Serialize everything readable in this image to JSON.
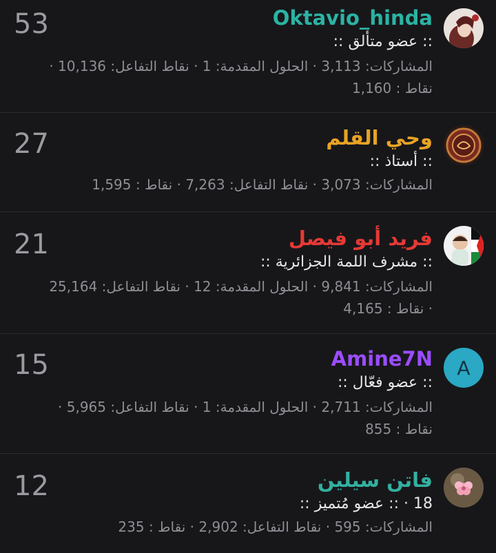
{
  "members": [
    {
      "score": "53",
      "username": "Oktavio_hinda",
      "username_color": "#2bb3a3",
      "title": ":: عضو متألق ::",
      "prefix": "",
      "stats_line1": "المشاركات: 3,113 · الحلول المقدمة: 1 · نقاط التفاعل: 10,136 ·",
      "stats_line2": "نقاط : 1,160"
    },
    {
      "score": "27",
      "username": "وحي القلم",
      "username_color": "#e8a325",
      "title": ":: أستاذ ::",
      "prefix": "",
      "stats_line1": "المشاركات: 3,073 · نقاط التفاعل: 7,263 · نقاط : 1,595",
      "stats_line2": ""
    },
    {
      "score": "21",
      "username": "فريد أبو فيصل",
      "username_color": "#e53935",
      "title": ":: مشرف اللمة الجزائرية ::",
      "prefix": "",
      "stats_line1": "المشاركات: 9,841 · الحلول المقدمة: 12 · نقاط التفاعل: 25,164",
      "stats_line2": "· نقاط : 4,165"
    },
    {
      "score": "15",
      "username": "Amine7N",
      "username_color": "#9b4dff",
      "avatar_letter": "A",
      "title": ":: عضو فعّال ::",
      "prefix": "",
      "stats_line1": "المشاركات: 2,711 · الحلول المقدمة: 1 · نقاط التفاعل: 5,965 ·",
      "stats_line2": "نقاط : 855"
    },
    {
      "score": "12",
      "username": "فاتن سيلين",
      "username_color": "#33b0a0",
      "title": ":: عضو مُتميز ::",
      "prefix": "18 ·",
      "stats_line1": "المشاركات: 595 · نقاط التفاعل: 2,902 · نقاط : 235",
      "stats_line2": ""
    }
  ]
}
